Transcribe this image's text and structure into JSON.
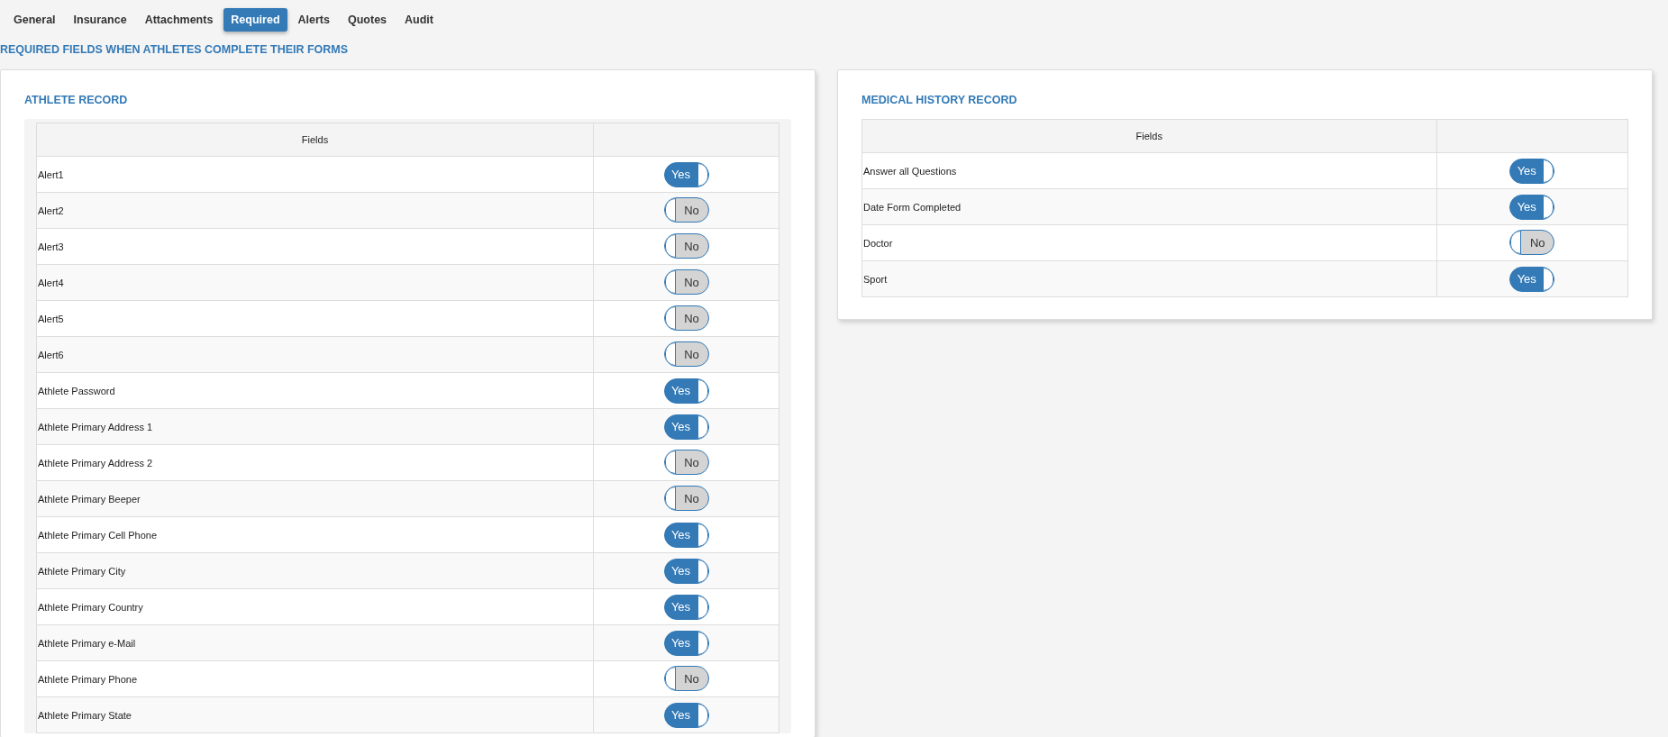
{
  "tabs": [
    {
      "label": "General",
      "selected": false
    },
    {
      "label": "Insurance",
      "selected": false
    },
    {
      "label": "Attachments",
      "selected": false
    },
    {
      "label": "Required",
      "selected": true
    },
    {
      "label": "Alerts",
      "selected": false
    },
    {
      "label": "Quotes",
      "selected": false
    },
    {
      "label": "Audit",
      "selected": false
    }
  ],
  "page_title": "REQUIRED FIELDS WHEN ATHLETES COMPLETE THEIR FORMS",
  "panels": [
    {
      "title": "ATHLETE RECORD",
      "columns": [
        "Fields"
      ],
      "wrapped": true,
      "rows": [
        {
          "field": "Alert1",
          "on": true,
          "toggle": "Yes"
        },
        {
          "field": "Alert2",
          "on": false,
          "toggle": "No"
        },
        {
          "field": "Alert3",
          "on": false,
          "toggle": "No"
        },
        {
          "field": "Alert4",
          "on": false,
          "toggle": "No"
        },
        {
          "field": "Alert5",
          "on": false,
          "toggle": "No"
        },
        {
          "field": "Alert6",
          "on": false,
          "toggle": "No"
        },
        {
          "field": "Athlete Password",
          "on": true,
          "toggle": "Yes"
        },
        {
          "field": "Athlete Primary Address 1",
          "on": true,
          "toggle": "Yes"
        },
        {
          "field": "Athlete Primary Address 2",
          "on": false,
          "toggle": "No"
        },
        {
          "field": "Athlete Primary Beeper",
          "on": false,
          "toggle": "No"
        },
        {
          "field": "Athlete Primary Cell Phone",
          "on": true,
          "toggle": "Yes"
        },
        {
          "field": "Athlete Primary City",
          "on": true,
          "toggle": "Yes"
        },
        {
          "field": "Athlete Primary Country",
          "on": true,
          "toggle": "Yes"
        },
        {
          "field": "Athlete Primary e-Mail",
          "on": true,
          "toggle": "Yes"
        },
        {
          "field": "Athlete Primary Phone",
          "on": false,
          "toggle": "No"
        },
        {
          "field": "Athlete Primary State",
          "on": true,
          "toggle": "Yes"
        }
      ]
    },
    {
      "title": "MEDICAL HISTORY RECORD",
      "columns": [
        "Fields"
      ],
      "wrapped": false,
      "rows": [
        {
          "field": "Answer all Questions",
          "on": true,
          "toggle": "Yes"
        },
        {
          "field": "Date Form Completed",
          "on": true,
          "toggle": "Yes"
        },
        {
          "field": "Doctor",
          "on": false,
          "toggle": "No"
        },
        {
          "field": "Sport",
          "on": true,
          "toggle": "Yes"
        }
      ]
    }
  ]
}
